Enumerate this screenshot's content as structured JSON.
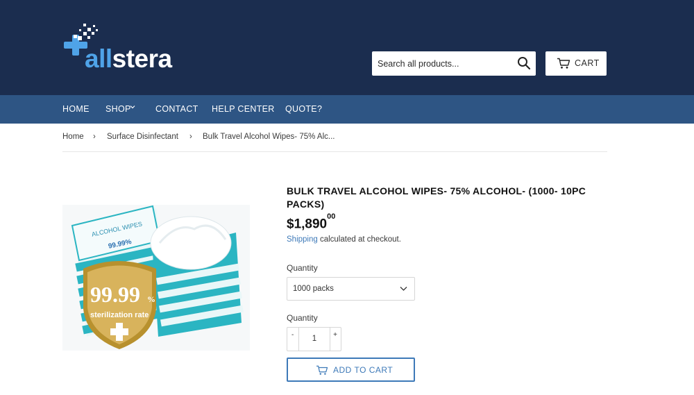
{
  "header": {
    "logo_part1": "all",
    "logo_part2": "stera",
    "search_placeholder": "Search all products...",
    "search_icon": "search-icon",
    "cart_label": "CART",
    "cart_icon": "cart-icon"
  },
  "colors": {
    "header_bg": "#1b2d4f",
    "nav_bg": "#2e5584",
    "accent": "#3d79b8",
    "logo_blue": "#4fa3e8"
  },
  "nav": {
    "items": [
      "HOME",
      "SHOP",
      "CONTACT",
      "HELP CENTER",
      "QUOTE?"
    ]
  },
  "breadcrumb": {
    "home": "Home",
    "category": "Surface Disinfectant",
    "current": "Bulk Travel Alcohol Wipes- 75% Alc...",
    "separator": "›"
  },
  "product": {
    "title": "BULK TRAVEL ALCOHOL WIPES- 75% ALCOHOL- (1000- 10PC PACKS)",
    "price_main": "$1,890",
    "price_cents": "00",
    "shipping_link": "Shipping",
    "shipping_rest": " calculated at checkout.",
    "image": {
      "pack_label": "ALCOHOL WIPES",
      "pack_sub": "99.99%",
      "badge_percent": "99.99",
      "badge_percent_small": "%",
      "badge_text": "sterilization rate"
    },
    "variant_label": "Quantity",
    "variant_value": "1000 packs",
    "quantity_label": "Quantity",
    "quantity_value": "1",
    "minus": "-",
    "plus": "+",
    "add_to_cart": "ADD TO CART"
  }
}
